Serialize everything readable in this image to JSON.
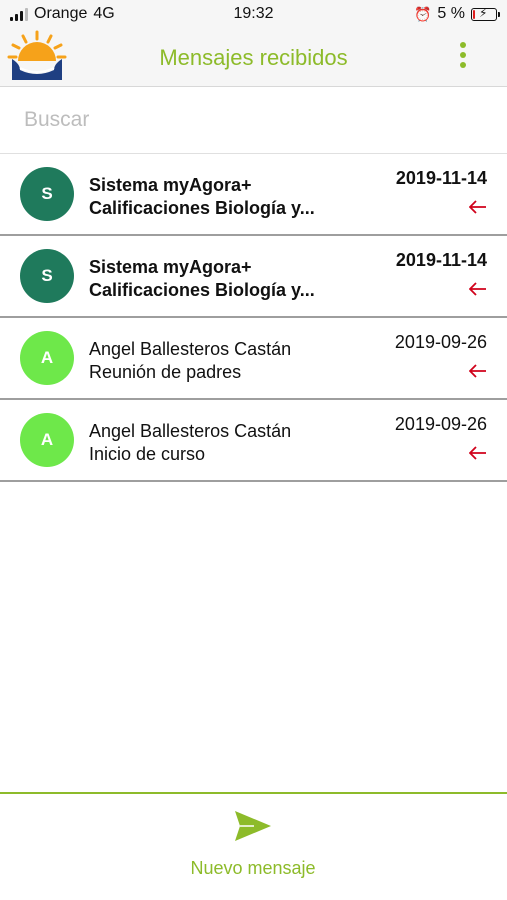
{
  "status_bar": {
    "carrier": "Orange",
    "network": "4G",
    "time": "19:32",
    "battery": "5 %"
  },
  "header": {
    "title": "Mensajes recibidos"
  },
  "search": {
    "placeholder": "Buscar",
    "value": ""
  },
  "messages": [
    {
      "initial": "S",
      "sender": "Sistema myAgora+",
      "subject": "Calificaciones Biología y...",
      "date": "2019-11-14",
      "unread": true,
      "avatar_color": "#1f7a5c"
    },
    {
      "initial": "S",
      "sender": "Sistema myAgora+",
      "subject": "Calificaciones Biología y...",
      "date": "2019-11-14",
      "unread": true,
      "avatar_color": "#1f7a5c"
    },
    {
      "initial": "A",
      "sender": "Angel Ballesteros Castán",
      "subject": "Reunión de padres",
      "date": "2019-09-26",
      "unread": false,
      "avatar_color": "#6ee84a"
    },
    {
      "initial": "A",
      "sender": "Angel Ballesteros Castán",
      "subject": "Inicio de curso",
      "date": "2019-09-26",
      "unread": false,
      "avatar_color": "#6ee84a"
    }
  ],
  "icons": {
    "reply": "arrow-left-icon",
    "send": "send-icon",
    "menu": "more-vertical-icon"
  },
  "colors": {
    "accent": "#8dbb2a",
    "reply_arrow": "#d0021b"
  },
  "footer": {
    "new_message_label": "Nuevo mensaje"
  }
}
